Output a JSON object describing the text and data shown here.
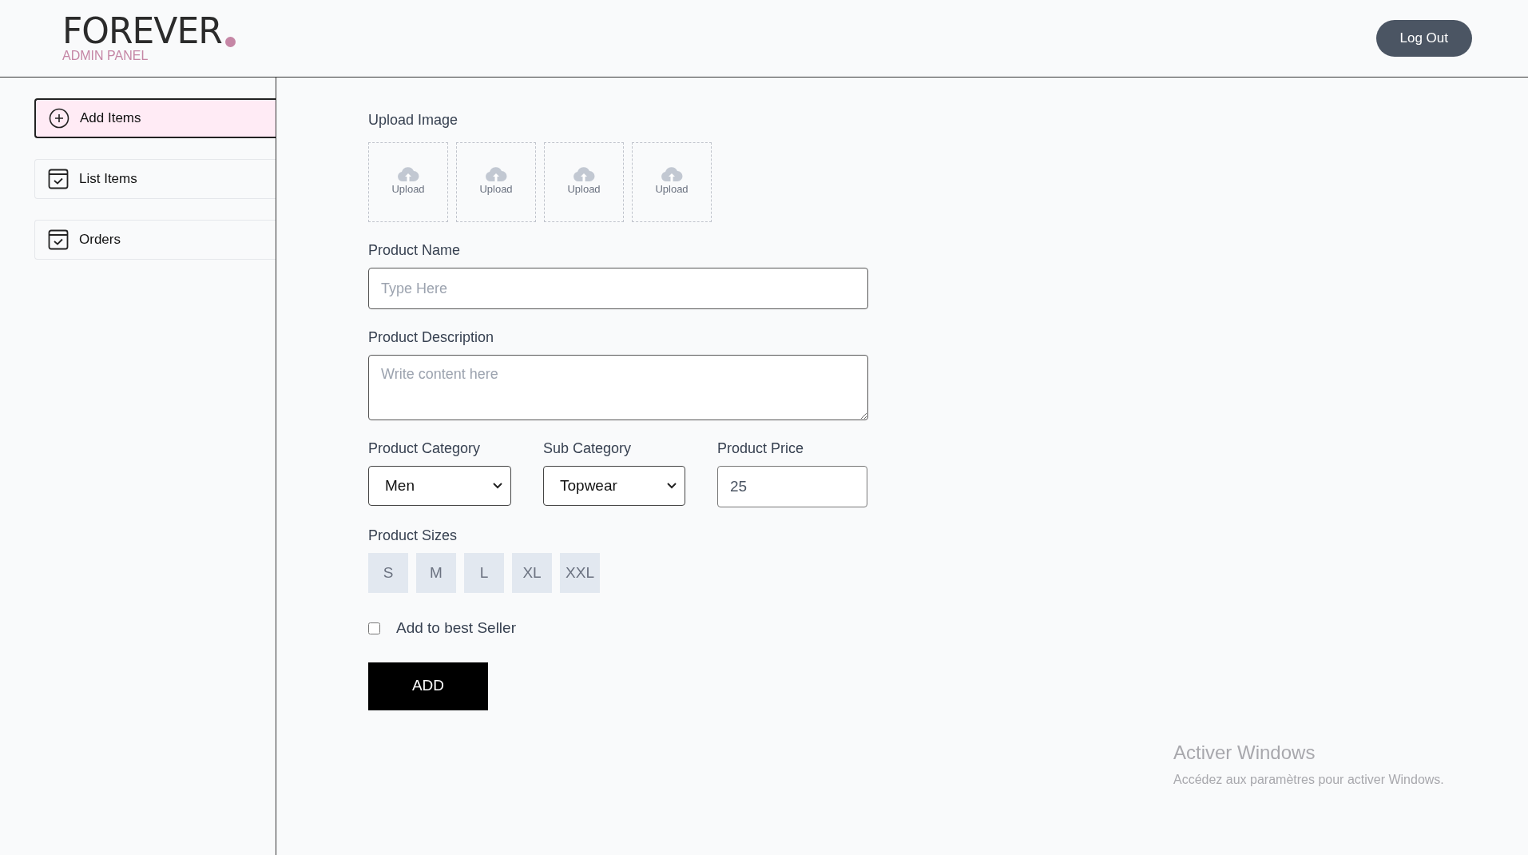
{
  "header": {
    "logo": "FOREVER",
    "subtitle": "ADMIN PANEL",
    "logout": "Log Out"
  },
  "sidebar": {
    "items": [
      {
        "label": "Add Items",
        "selected": true
      },
      {
        "label": "List Items",
        "selected": false
      },
      {
        "label": "Orders",
        "selected": false
      }
    ]
  },
  "form": {
    "upload_label": "Upload Image",
    "uploads": [
      "Upload",
      "Upload",
      "Upload",
      "Upload"
    ],
    "name_label": "Product Name",
    "name_placeholder": "Type Here",
    "description_label": "Product Description",
    "description_placeholder": "Write content here",
    "category_label": "Product Category",
    "category_value": "Men",
    "subcategory_label": "Sub Category",
    "subcategory_value": "Topwear",
    "price_label": "Product Price",
    "price_value": "25",
    "sizes_label": "Product Sizes",
    "sizes": [
      {
        "label": "S",
        "selected": false
      },
      {
        "label": "M",
        "selected": false
      },
      {
        "label": "L",
        "selected": false
      },
      {
        "label": "XL",
        "selected": false
      },
      {
        "label": "XXL",
        "selected": false
      }
    ],
    "bestseller": {
      "label": "Add to best Seller",
      "checked": false
    },
    "submit": "ADD"
  },
  "os_notice": {
    "title": "Activer Windows",
    "text": "Accédez aux paramètres pour activer Windows."
  }
}
